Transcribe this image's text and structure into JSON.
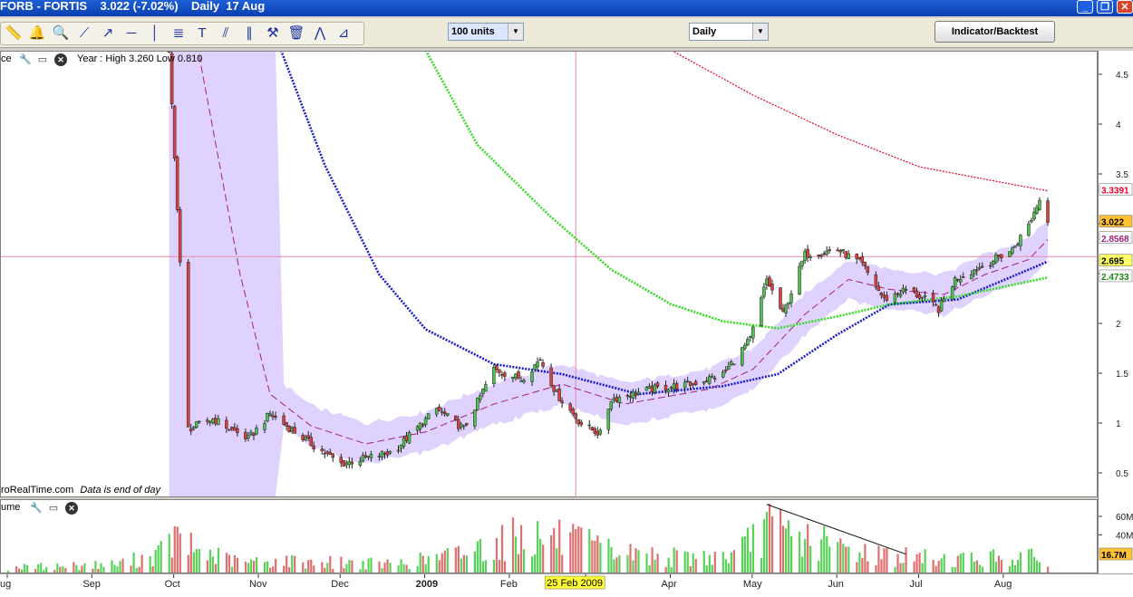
{
  "title": {
    "symbol": "FORB - FORTIS",
    "price": "3.022",
    "change": "(-7.02%)",
    "period": "Daily",
    "date": "17 Aug"
  },
  "window_controls": [
    "minimize-icon",
    "restore-icon",
    "close-icon"
  ],
  "toolbar": {
    "icons": [
      "ruler-icon",
      "alarm-bell-icon",
      "zoom-icon",
      "trendline-icon",
      "ray-icon",
      "horizontal-line-icon",
      "vertical-line-icon",
      "fibonacci-icon",
      "text-icon",
      "channel-icon",
      "parallel-lines-icon",
      "hammer-icon",
      "trash-icon",
      "pattern-icon",
      "gann-icon"
    ],
    "units_select": "100 units",
    "period_select": "Daily",
    "indicator_button": "Indicator/Backtest"
  },
  "price_panel": {
    "header_label": "ce",
    "year_info": "Year : High 3.260 Low 0.810",
    "footer_source": "roRealTime.com",
    "footer_note": "Data is end of day"
  },
  "volume_panel": {
    "header_label": "ume"
  },
  "crosshair_date": "25 Feb 2009",
  "chart_data": [
    {
      "type": "candlestick",
      "ylim": [
        0.25,
        4.75
      ],
      "y_ticks": [
        "4.5",
        "4",
        "3.5",
        "3",
        "2.5",
        "2",
        "1.5",
        "1",
        "0.5"
      ],
      "x_ticks": [
        "ug",
        "Sep",
        "Oct",
        "Nov",
        "Dec",
        "2009",
        "Feb",
        "Mar",
        "Apr",
        "May",
        "Jun",
        "Jul",
        "Aug"
      ],
      "period_start": "2008-08-01",
      "period_end": "2009-08-17",
      "price_path": [
        [
          "2008-09-29",
          4.7
        ],
        [
          "2008-10-01",
          3.7
        ],
        [
          "2008-10-06",
          0.95
        ],
        [
          "2008-10-15",
          1.05
        ],
        [
          "2008-10-28",
          0.85
        ],
        [
          "2008-11-05",
          1.1
        ],
        [
          "2008-11-20",
          0.8
        ],
        [
          "2008-12-01",
          0.6
        ],
        [
          "2008-12-20",
          0.72
        ],
        [
          "2009-01-05",
          1.15
        ],
        [
          "2009-01-15",
          0.95
        ],
        [
          "2009-01-26",
          1.55
        ],
        [
          "2009-02-05",
          1.45
        ],
        [
          "2009-02-12",
          1.65
        ],
        [
          "2009-02-18",
          1.3
        ],
        [
          "2009-02-27",
          1.0
        ],
        [
          "2009-03-06",
          0.9
        ],
        [
          "2009-03-10",
          1.25
        ],
        [
          "2009-03-25",
          1.35
        ],
        [
          "2009-04-08",
          1.4
        ],
        [
          "2009-04-20",
          1.5
        ],
        [
          "2009-04-30",
          1.85
        ],
        [
          "2009-05-06",
          2.45
        ],
        [
          "2009-05-12",
          2.1
        ],
        [
          "2009-05-20",
          2.7
        ],
        [
          "2009-06-01",
          2.75
        ],
        [
          "2009-06-10",
          2.6
        ],
        [
          "2009-06-18",
          2.25
        ],
        [
          "2009-06-26",
          2.35
        ],
        [
          "2009-07-03",
          2.25
        ],
        [
          "2009-07-08",
          2.15
        ],
        [
          "2009-07-14",
          2.45
        ],
        [
          "2009-07-25",
          2.6
        ],
        [
          "2009-08-04",
          2.75
        ],
        [
          "2009-08-10",
          3.0
        ],
        [
          "2009-08-14",
          3.25
        ],
        [
          "2009-08-17",
          3.022
        ]
      ],
      "indicators": [
        {
          "color": "#e8002a",
          "style": "dotted",
          "value": "3.3391",
          "points": [
            [
              "2009-04-01",
              4.75
            ],
            [
              "2009-05-01",
              4.3
            ],
            [
              "2009-06-01",
              3.9
            ],
            [
              "2009-07-01",
              3.58
            ],
            [
              "2009-08-01",
              3.42
            ],
            [
              "2009-08-17",
              3.3391
            ]
          ]
        },
        {
          "color": "#1a1ad0",
          "style": "dotted",
          "value": "2.695",
          "points": [
            [
              "2008-11-09",
              4.75
            ],
            [
              "2008-11-25",
              3.6
            ],
            [
              "2008-12-15",
              2.5
            ],
            [
              "2009-01-01",
              1.95
            ],
            [
              "2009-01-26",
              1.6
            ],
            [
              "2009-02-20",
              1.5
            ],
            [
              "2009-03-20",
              1.3
            ],
            [
              "2009-04-20",
              1.38
            ],
            [
              "2009-05-10",
              1.5
            ],
            [
              "2009-06-01",
              1.9
            ],
            [
              "2009-06-20",
              2.2
            ],
            [
              "2009-07-15",
              2.25
            ],
            [
              "2009-08-17",
              2.63
            ]
          ]
        },
        {
          "color": "#33dd22",
          "style": "dotted",
          "value": "2.4733",
          "points": [
            [
              "2009-01-01",
              4.75
            ],
            [
              "2009-01-20",
              3.8
            ],
            [
              "2009-02-15",
              3.1
            ],
            [
              "2009-03-10",
              2.55
            ],
            [
              "2009-04-01",
              2.2
            ],
            [
              "2009-04-20",
              2.03
            ],
            [
              "2009-05-10",
              1.96
            ],
            [
              "2009-06-01",
              2.08
            ],
            [
              "2009-06-20",
              2.2
            ],
            [
              "2009-07-15",
              2.28
            ],
            [
              "2009-08-17",
              2.47
            ]
          ]
        },
        {
          "color": "#a0207f",
          "style": "dashed",
          "value": "2.8568",
          "points": [
            [
              "2008-10-10",
              4.7
            ],
            [
              "2008-10-25",
              2.5
            ],
            [
              "2008-11-05",
              1.3
            ],
            [
              "2008-11-20",
              0.98
            ],
            [
              "2008-12-10",
              0.8
            ],
            [
              "2009-01-01",
              0.92
            ],
            [
              "2009-01-26",
              1.2
            ],
            [
              "2009-02-20",
              1.4
            ],
            [
              "2009-03-15",
              1.2
            ],
            [
              "2009-04-15",
              1.35
            ],
            [
              "2009-05-01",
              1.55
            ],
            [
              "2009-05-20",
              2.1
            ],
            [
              "2009-06-05",
              2.45
            ],
            [
              "2009-06-20",
              2.35
            ],
            [
              "2009-07-10",
              2.3
            ],
            [
              "2009-07-25",
              2.5
            ],
            [
              "2009-08-10",
              2.65
            ],
            [
              "2009-08-17",
              2.85
            ]
          ]
        }
      ],
      "current_value_label": "3.022",
      "horizontal_cursor_level": 2.68
    },
    {
      "type": "bar",
      "ylim": [
        0,
        80
      ],
      "y_ticks": [
        "60M",
        "40M"
      ],
      "current_value_label": "16.7M",
      "volume_profile_millions": [
        [
          "2008-08-01",
          6
        ],
        [
          "2008-09-10",
          10
        ],
        [
          "2008-09-25",
          22
        ],
        [
          "2008-10-01",
          40
        ],
        [
          "2008-10-10",
          25
        ],
        [
          "2008-10-25",
          12
        ],
        [
          "2008-11-10",
          14
        ],
        [
          "2008-12-01",
          12
        ],
        [
          "2008-12-20",
          10
        ],
        [
          "2009-01-10",
          20
        ],
        [
          "2009-01-26",
          35
        ],
        [
          "2009-02-05",
          45
        ],
        [
          "2009-02-20",
          40
        ],
        [
          "2009-03-10",
          25
        ],
        [
          "2009-04-01",
          18
        ],
        [
          "2009-04-25",
          20
        ],
        [
          "2009-05-05",
          55
        ],
        [
          "2009-05-15",
          45
        ],
        [
          "2009-06-01",
          30
        ],
        [
          "2009-06-20",
          20
        ],
        [
          "2009-07-10",
          16
        ],
        [
          "2009-08-01",
          18
        ],
        [
          "2009-08-17",
          17
        ]
      ],
      "trendline": [
        [
          "2009-05-06",
          74
        ],
        [
          "2009-06-26",
          20
        ]
      ]
    }
  ],
  "colors": {
    "up_candle": "#4ec14e",
    "down_candle": "#d94141",
    "volume_up": "#58d258",
    "volume_down": "#dd6f6f",
    "band_fill": "#e0d2ff",
    "crosshair": "#e88aa8",
    "label_highlight": "#ffc233"
  }
}
